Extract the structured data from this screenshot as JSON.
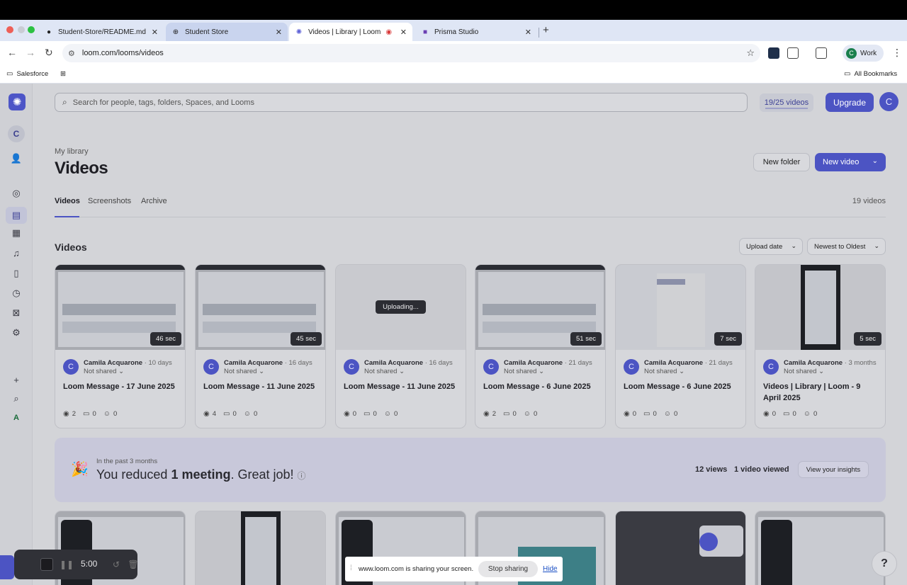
{
  "browser": {
    "tabs": [
      {
        "label": "Student-Store/README.md a",
        "icon": "github-icon"
      },
      {
        "label": "Student Store",
        "icon": "globe-icon"
      },
      {
        "label": "Videos | Library | Loom",
        "icon": "loom-icon"
      },
      {
        "label": "Prisma Studio",
        "icon": "prisma-icon"
      }
    ],
    "url": "loom.com/looms/videos",
    "profile_label": "Work",
    "profile_initial": "C",
    "bookmarks": {
      "salesforce": "Salesforce",
      "all": "All Bookmarks"
    }
  },
  "app": {
    "sidebar_initial": "C",
    "sidebar_badge": "A",
    "search_placeholder": "Search for people, tags, folders, Spaces, and Looms",
    "quota": "19/25 videos",
    "upgrade": "Upgrade",
    "user_initial": "C",
    "breadcrumb": "My library",
    "title": "Videos",
    "new_folder": "New folder",
    "new_video": "New video",
    "tabs": [
      "Videos",
      "Screenshots",
      "Archive"
    ],
    "video_count": "19 videos",
    "section_title": "Videos",
    "sort_by": "Upload date",
    "sort_order": "Newest to Oldest"
  },
  "videos": [
    {
      "owner": "Camila Acquarone",
      "age": "· 10 days",
      "shared": "Not shared ⌄",
      "title": "Loom Message - 17 June 2025",
      "duration": "46 sec",
      "views": "2",
      "comments": "0",
      "reactions": "0"
    },
    {
      "owner": "Camila Acquarone",
      "age": "· 16 days",
      "shared": "Not shared ⌄",
      "title": "Loom Message - 11 June 2025",
      "duration": "45 sec",
      "views": "4",
      "comments": "0",
      "reactions": "0"
    },
    {
      "owner": "Camila Acquarone",
      "age": "· 16 days",
      "shared": "Not shared ⌄",
      "title": "Loom Message - 11 June 2025",
      "status": "Uploading...",
      "views": "0",
      "comments": "0",
      "reactions": "0"
    },
    {
      "owner": "Camila Acquarone",
      "age": "· 21 days",
      "shared": "Not shared ⌄",
      "title": "Loom Message - 6 June 2025",
      "duration": "51 sec",
      "views": "2",
      "comments": "0",
      "reactions": "0"
    },
    {
      "owner": "Camila Acquarone",
      "age": "· 21 days",
      "shared": "Not shared ⌄",
      "title": "Loom Message - 6 June 2025",
      "duration": "7 sec",
      "views": "0",
      "comments": "0",
      "reactions": "0"
    },
    {
      "owner": "Camila Acquarone",
      "age": "· 3 months",
      "shared": "Not shared ⌄",
      "title": "Videos | Library | Loom - 9 April 2025",
      "duration": "5 sec",
      "views": "0",
      "comments": "0",
      "reactions": "0"
    }
  ],
  "insights": {
    "period": "In the past 3 months",
    "msg_pre": "You reduced ",
    "msg_bold": "1 meeting",
    "msg_post": ". Great job!",
    "views": "12 views",
    "viewed": "1 video viewed",
    "button": "View your insights"
  },
  "recorder": {
    "time": "5:00"
  },
  "sharebar": {
    "message": "www.loom.com is sharing your screen.",
    "stop": "Stop sharing",
    "hide": "Hide"
  },
  "help": "?",
  "colors": {
    "accent": "#4c54c3",
    "page_dim": "#d3d4d8"
  }
}
